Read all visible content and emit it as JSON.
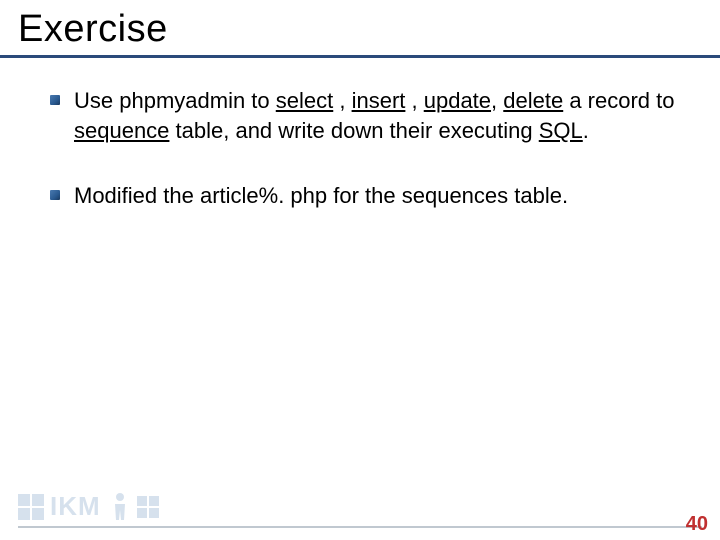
{
  "title": "Exercise",
  "bullets": [
    {
      "parts": [
        {
          "t": "Use phpmyadmin to "
        },
        {
          "t": "select",
          "u": true
        },
        {
          "t": " , "
        },
        {
          "t": "insert",
          "u": true
        },
        {
          "t": " , "
        },
        {
          "t": "update",
          "u": true
        },
        {
          "t": ", "
        },
        {
          "t": "delete",
          "u": true
        },
        {
          "t": " a record to "
        },
        {
          "t": "sequence",
          "u": true
        },
        {
          "t": " table, and write down their executing "
        },
        {
          "t": "SQL",
          "u": true
        },
        {
          "t": "."
        }
      ]
    },
    {
      "parts": [
        {
          "t": "Modified the article%. php for the sequences table."
        }
      ]
    }
  ],
  "footer": {
    "logo_text": "IKM",
    "page_number": "40"
  }
}
